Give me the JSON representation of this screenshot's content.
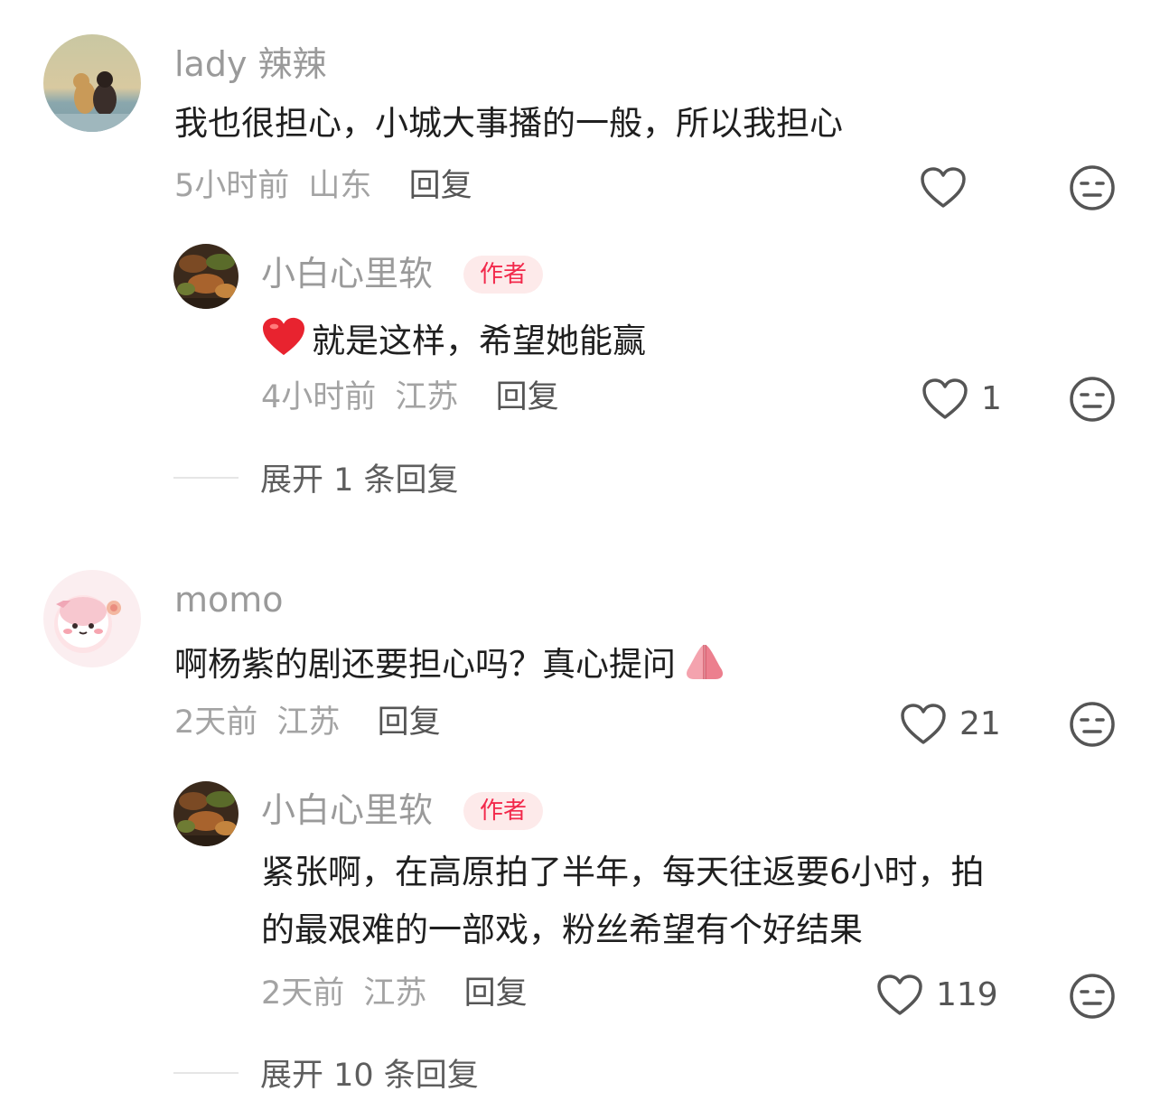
{
  "comments": [
    {
      "user": "lady 辣辣",
      "text": "我也很担心，小城大事播的一般，所以我担心",
      "time": "5小时前",
      "location": "山东",
      "reply_label": "回复",
      "likes": "",
      "reply": {
        "user": "小白心里软",
        "badge": "作者",
        "text": "就是这样，希望她能赢",
        "time": "4小时前",
        "location": "江苏",
        "reply_label": "回复",
        "likes": "1"
      },
      "expand_label": "展开 1 条回复"
    },
    {
      "user": "momo",
      "text": "啊杨紫的剧还要担心吗？真心提问",
      "time": "2天前",
      "location": "江苏",
      "reply_label": "回复",
      "likes": "21",
      "reply": {
        "user": "小白心里软",
        "badge": "作者",
        "text_line1": "紧张啊，在高原拍了半年，每天往返要6小时，拍",
        "text_line2": "的最艰难的一部戏，粉丝希望有个好结果",
        "time": "2天前",
        "location": "江苏",
        "reply_label": "回复",
        "likes": "119"
      },
      "expand_label": "展开 10 条回复"
    }
  ],
  "icons": {
    "like": "heart-outline-icon",
    "dislike": "meh-face-icon",
    "emoji_heart": "red-heart-emoji",
    "emoji_pray": "folded-hands-emoji"
  },
  "colors": {
    "badge_text": "#f2294b",
    "badge_bg": "#fdeaea",
    "meta": "#a3a3a3",
    "name": "#9a9a9a"
  }
}
